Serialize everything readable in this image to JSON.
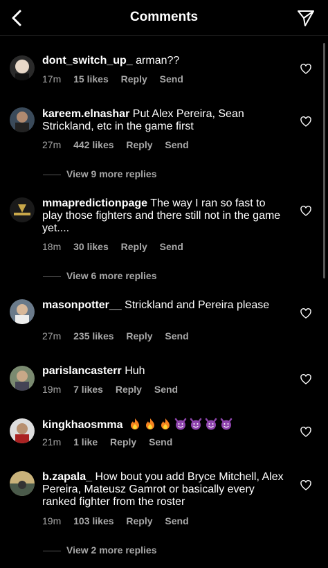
{
  "header": {
    "title": "Comments"
  },
  "comments": [
    {
      "username": "dont_switch_up_",
      "text": "arman??",
      "time": "17m",
      "likes": "15 likes",
      "reply": "Reply",
      "send": "Send"
    },
    {
      "username": "kareem.elnashar",
      "text": "Put Alex Pereira, Sean Strickland, etc in the game first",
      "time": "27m",
      "likes": "442 likes",
      "reply": "Reply",
      "send": "Send",
      "view_replies": "View 9 more replies"
    },
    {
      "username": "mmapredictionpage",
      "text": "The way I ran so fast to play those fighters and there still not in the game yet....",
      "time": "18m",
      "likes": "30 likes",
      "reply": "Reply",
      "send": "Send",
      "view_replies": "View 6 more replies"
    },
    {
      "username": "masonpotter__",
      "text": "Strickland and Pereira please",
      "time": "27m",
      "likes": "235 likes",
      "reply": "Reply",
      "send": "Send"
    },
    {
      "username": "parislancasterr",
      "text": "Huh",
      "time": "19m",
      "likes": "7 likes",
      "reply": "Reply",
      "send": "Send"
    },
    {
      "username": "kingkhaosmma",
      "text": "",
      "emoji": [
        "fire",
        "fire",
        "fire",
        "smiling-devil",
        "smiling-devil",
        "smiling-devil",
        "smiling-devil"
      ],
      "time": "21m",
      "likes": "1 like",
      "reply": "Reply",
      "send": "Send"
    },
    {
      "username": "b.zapala_",
      "text": "How bout you add Bryce Mitchell, Alex Pereira, Mateusz Gamrot or basically every ranked fighter from the roster",
      "time": "19m",
      "likes": "103 likes",
      "reply": "Reply",
      "send": "Send",
      "view_replies": "View 2 more replies"
    }
  ],
  "colors": {
    "background": "#000000",
    "text": "#ffffff",
    "secondary_text": "#a8a8a8",
    "divider": "#1f1f1f"
  },
  "icons": {
    "back": "chevron-left-icon",
    "share": "paper-plane-icon",
    "like": "heart-outline-icon"
  }
}
